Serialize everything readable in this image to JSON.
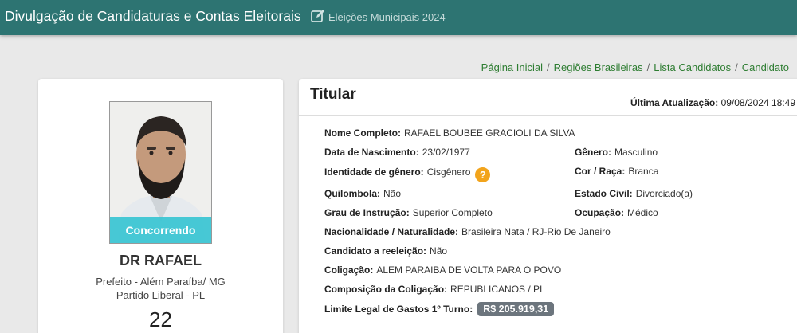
{
  "header": {
    "title": "Divulgação de Candidaturas e Contas Eleitorais",
    "subtitle": "Eleições Municipais 2024",
    "edit_icon": "edit-icon"
  },
  "breadcrumb": [
    "Página Inicial",
    "Regiões Brasileiras",
    "Lista Candidatos",
    "Candidato"
  ],
  "candidate": {
    "status": "Concorrendo",
    "ballot_name": "DR RAFAEL",
    "office_location": "Prefeito - Além Paraíba/ MG",
    "party": "Partido Liberal - PL",
    "number": "22"
  },
  "details": {
    "heading": "Titular",
    "updated_label": "Última Atualização:",
    "updated_value": "09/08/2024 18:49",
    "fields": {
      "nome_completo": {
        "label": "Nome Completo:",
        "value": "RAFAEL BOUBEE GRACIOLI DA SILVA"
      },
      "nascimento": {
        "label": "Data de Nascimento:",
        "value": "23/02/1977"
      },
      "genero": {
        "label": "Gênero:",
        "value": "Masculino"
      },
      "identidade": {
        "label": "Identidade de gênero:",
        "value": "Cisgênero"
      },
      "cor_raca": {
        "label": "Cor / Raça:",
        "value": "Branca"
      },
      "quilombola": {
        "label": "Quilombola:",
        "value": "Não"
      },
      "estado_civil": {
        "label": "Estado Civil:",
        "value": "Divorciado(a)"
      },
      "instrucao": {
        "label": "Grau de Instrução:",
        "value": "Superior Completo"
      },
      "ocupacao": {
        "label": "Ocupação:",
        "value": "Médico"
      },
      "nacionalidade": {
        "label": "Nacionalidade / Naturalidade:",
        "value": "Brasileira Nata / RJ-Rio De Janeiro"
      },
      "reeleicao": {
        "label": "Candidato a reeleição:",
        "value": "Não"
      },
      "coligacao": {
        "label": "Coligação:",
        "value": "ALEM PARAIBA DE VOLTA PARA O POVO"
      },
      "composicao": {
        "label": "Composição da Coligação:",
        "value": "REPUBLICANOS / PL"
      },
      "limite": {
        "label": "Limite Legal de Gastos 1º Turno:",
        "value": "R$ 205.919,31"
      }
    },
    "help_symbol": "?"
  },
  "colors": {
    "topbar": "#2d7472",
    "status_badge": "#38c4d2",
    "link": "#2e7d32",
    "help_icon": "#f2a41c",
    "money_badge": "#6c757d"
  }
}
